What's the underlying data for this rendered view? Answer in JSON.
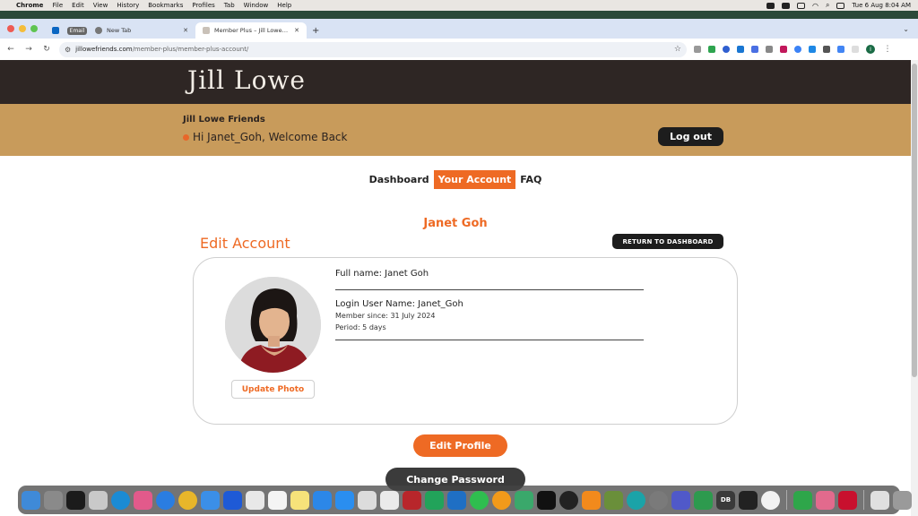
{
  "menubar": {
    "app": "Chrome",
    "items": [
      "File",
      "Edit",
      "View",
      "History",
      "Bookmarks",
      "Profiles",
      "Tab",
      "Window",
      "Help"
    ],
    "datetime": "Tue 6 Aug  8:04 AM"
  },
  "browser": {
    "tabs": [
      {
        "label": "Email",
        "pinned": true
      },
      {
        "label": "New Tab"
      },
      {
        "label": "Member Plus – Jill Lowe Frien",
        "active": true
      }
    ],
    "url_host": "jillowefriends.com",
    "url_path": "/member-plus/member-plus-account/",
    "profile_initial": "I"
  },
  "site": {
    "logo": "Jill Lowe",
    "site_name": "Jill Lowe Friends",
    "welcome": "Hi Janet_Goh, Welcome Back",
    "logout": "Log out",
    "nav": [
      {
        "label": "Dashboard"
      },
      {
        "label": "Your Account",
        "active": true
      },
      {
        "label": "FAQ"
      }
    ],
    "member_name": "Janet Goh",
    "edit_title": "Edit Account",
    "return_button": "RETURN TO DASHBOARD",
    "account": {
      "full_name": "Full name: Janet Goh",
      "login": "Login User Name: Janet_Goh",
      "member_since": "Member since: 31 July 2024",
      "period": "Period: 5 days"
    },
    "update_photo": "Update Photo",
    "edit_profile": "Edit Profile",
    "change_password": "Change Password"
  },
  "dock": {
    "labels": [
      "DB"
    ]
  },
  "colors": {
    "accent": "#ee6a24",
    "header": "#2e2624",
    "member_bar": "#c89b5b"
  }
}
